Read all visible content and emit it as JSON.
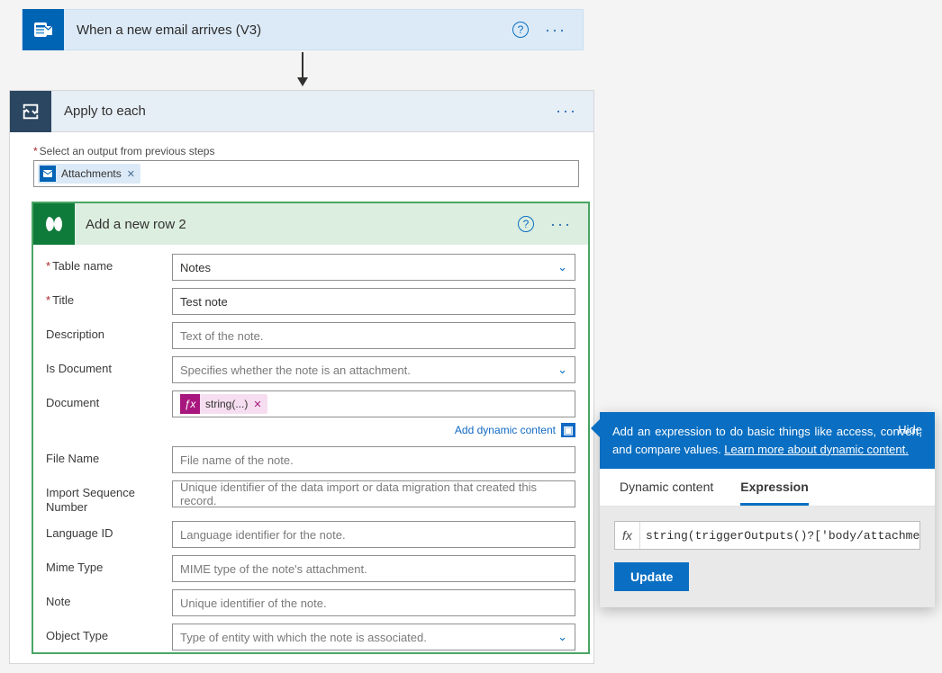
{
  "trigger": {
    "title": "When a new email arrives (V3)"
  },
  "loop": {
    "title": "Apply to each",
    "output_label": "Select an output from previous steps",
    "token_label": "Attachments"
  },
  "dv": {
    "title": "Add a new row 2",
    "fields": {
      "table_name": {
        "label": "Table name",
        "value": "Notes"
      },
      "title": {
        "label": "Title",
        "value": "Test note"
      },
      "description": {
        "label": "Description",
        "placeholder": "Text of the note."
      },
      "is_document": {
        "label": "Is Document",
        "placeholder": "Specifies whether the note is an attachment."
      },
      "document": {
        "label": "Document",
        "expression_display": "string(...)"
      },
      "file_name": {
        "label": "File Name",
        "placeholder": "File name of the note."
      },
      "import_seq": {
        "label": "Import Sequence Number",
        "placeholder": "Unique identifier of the data import or data migration that created this record."
      },
      "lang_id": {
        "label": "Language ID",
        "placeholder": "Language identifier for the note."
      },
      "mime_type": {
        "label": "Mime Type",
        "placeholder": "MIME type of the note's attachment."
      },
      "note": {
        "label": "Note",
        "placeholder": "Unique identifier of the note."
      },
      "object_type": {
        "label": "Object Type",
        "placeholder": "Type of entity with which the note is associated."
      }
    },
    "dynamic_link": "Add dynamic content"
  },
  "popout": {
    "banner_prefix": "Add an expression to do basic things like access, convert, and compare values. ",
    "banner_link": "Learn more about dynamic content.",
    "hide": "Hide",
    "tabs": {
      "dynamic": "Dynamic content",
      "expression": "Expression"
    },
    "fx_label": "fx",
    "expression_value": "string(triggerOutputs()?['body/attachments",
    "update": "Update"
  }
}
